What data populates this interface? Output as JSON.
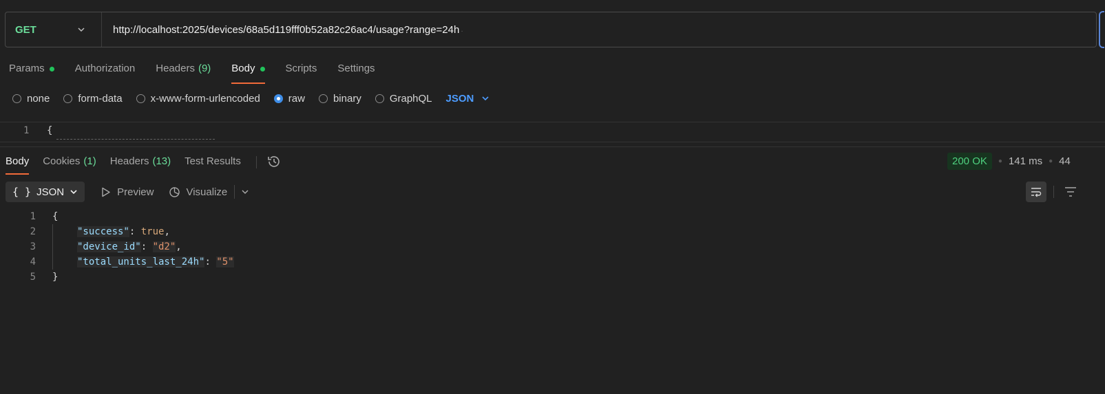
{
  "request": {
    "method": "GET",
    "url": "http://localhost:2025/devices/68a5d119fff0b52a82c26ac4/usage?range=24h"
  },
  "request_tabs": [
    {
      "label": "Params",
      "count": "",
      "dot": true
    },
    {
      "label": "Authorization",
      "count": "",
      "dot": false
    },
    {
      "label": "Headers",
      "count": "(9)",
      "dot": false
    },
    {
      "label": "Body",
      "count": "",
      "dot": true,
      "active": true
    },
    {
      "label": "Scripts",
      "count": "",
      "dot": false
    },
    {
      "label": "Settings",
      "count": "",
      "dot": false
    }
  ],
  "body_types": {
    "options": [
      "none",
      "form-data",
      "x-www-form-urlencoded",
      "raw",
      "binary",
      "GraphQL"
    ],
    "selected": "raw",
    "language": "JSON"
  },
  "request_editor": {
    "line_number": "1",
    "first_line": "{"
  },
  "response_tabs": [
    {
      "label": "Body",
      "count": "",
      "active": true
    },
    {
      "label": "Cookies",
      "count": "(1)"
    },
    {
      "label": "Headers",
      "count": "(13)"
    },
    {
      "label": "Test Results",
      "count": ""
    }
  ],
  "status": {
    "code": "200 OK",
    "time": "141 ms",
    "size": "44"
  },
  "response_toolbar": {
    "format_braces": "{ }",
    "format": "JSON",
    "preview": "Preview",
    "visualize": "Visualize"
  },
  "response_body": {
    "line_numbers": [
      "1",
      "2",
      "3",
      "4",
      "5"
    ],
    "open": "{",
    "close": "}",
    "lines": [
      {
        "key": "\"success\"",
        "value": "true",
        "type": "bool",
        "trail": ","
      },
      {
        "key": "\"device_id\"",
        "value": "\"d2\"",
        "type": "str",
        "trail": ","
      },
      {
        "key": "\"total_units_last_24h\"",
        "value": "\"5\"",
        "type": "str",
        "trail": ""
      }
    ]
  },
  "colors": {
    "accent_tab": "#f26b3a",
    "method_get": "#6bdd9a",
    "status_ok": "#4fd17f",
    "link_blue": "#4d9cff"
  }
}
